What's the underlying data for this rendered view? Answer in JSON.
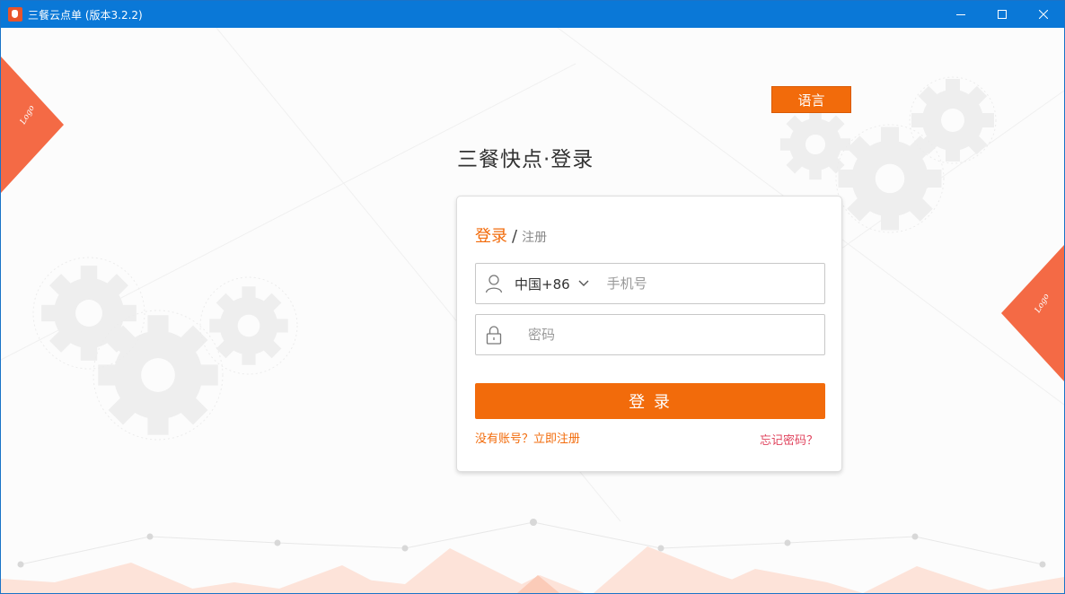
{
  "window": {
    "title": "三餐云点单 (版本3.2.2)",
    "controls": {
      "minimize": "minimize-icon",
      "maximize": "maximize-icon",
      "close": "close-icon"
    }
  },
  "language_button": "语言",
  "page_title": "三餐快点·登录",
  "login_card": {
    "tab_login": "登录",
    "tab_separator": "/",
    "tab_register": "注册",
    "country_code": "中国+86",
    "phone_placeholder": "手机号",
    "password_placeholder": "密码",
    "submit_label": "登 录",
    "register_link": "没有账号？立即注册",
    "forgot_link": "忘记密码？"
  },
  "colors": {
    "accent": "#f26b0b",
    "titlebar": "#0a78d7",
    "forgot_link": "#e0445e"
  },
  "icons": {
    "user": "user-icon",
    "lock": "lock-icon",
    "dropdown": "chevron-down-icon"
  }
}
